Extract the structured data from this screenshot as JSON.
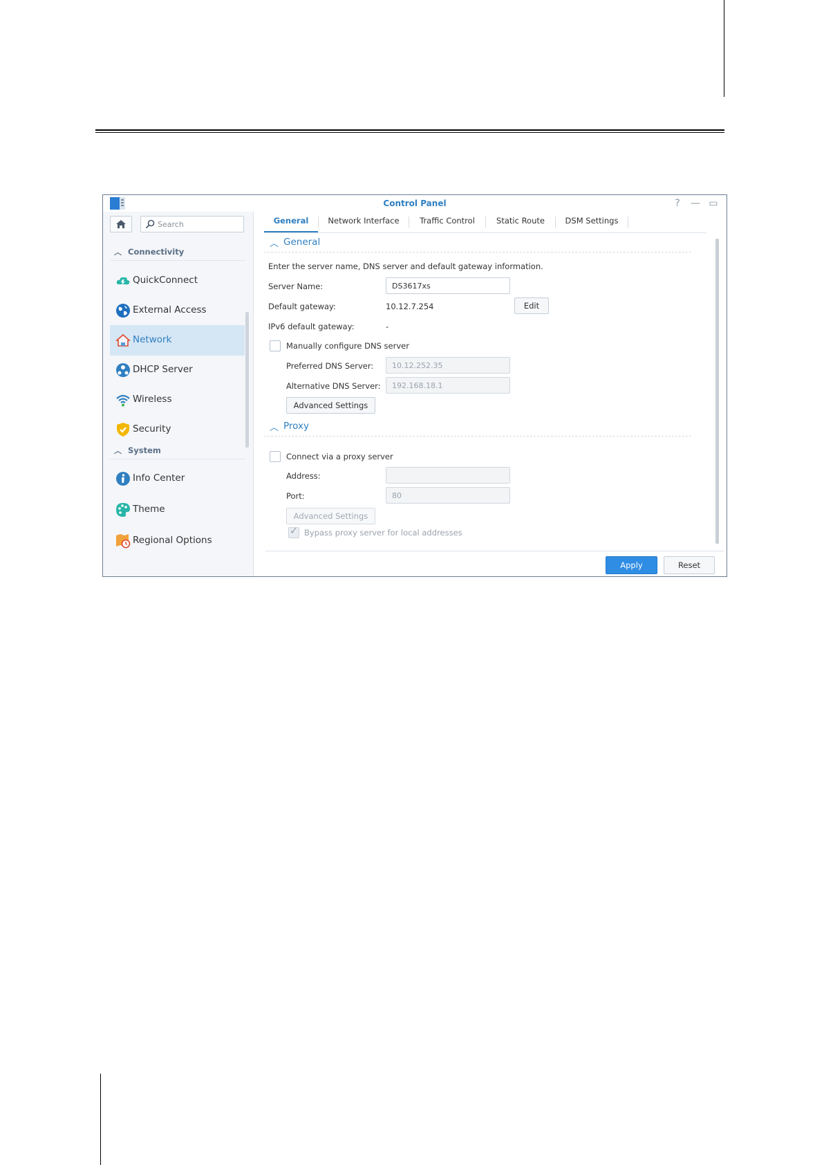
{
  "window": {
    "title": "Control Panel",
    "controls": [
      "?",
      "—",
      "▭",
      "✕"
    ]
  },
  "sidebar": {
    "search_placeholder": "Search",
    "sections": [
      {
        "label": "Connectivity",
        "items": [
          {
            "label": "QuickConnect",
            "icon": "quickconnect-icon"
          },
          {
            "label": "External Access",
            "icon": "globe-icon"
          },
          {
            "label": "Network",
            "icon": "house-icon",
            "active": true
          },
          {
            "label": "DHCP Server",
            "icon": "dhcp-icon"
          },
          {
            "label": "Wireless",
            "icon": "wifi-icon"
          },
          {
            "label": "Security",
            "icon": "shield-icon"
          }
        ]
      },
      {
        "label": "System",
        "items": [
          {
            "label": "Info Center",
            "icon": "info-icon"
          },
          {
            "label": "Theme",
            "icon": "palette-icon"
          },
          {
            "label": "Regional Options",
            "icon": "regional-icon"
          }
        ]
      }
    ]
  },
  "tabs": [
    "General",
    "Network Interface",
    "Traffic Control",
    "Static Route",
    "DSM Settings"
  ],
  "general": {
    "heading": "General",
    "description": "Enter the server name, DNS server and default gateway information.",
    "server_name_label": "Server Name:",
    "server_name_value": "DS3617xs",
    "default_gateway_label": "Default gateway:",
    "default_gateway_value": "10.12.7.254",
    "edit_label": "Edit",
    "ipv6_gateway_label": "IPv6 default gateway:",
    "ipv6_gateway_value": "-",
    "manual_dns_label": "Manually configure DNS server",
    "preferred_dns_label": "Preferred DNS Server:",
    "preferred_dns_value": "10.12.252.35",
    "alternative_dns_label": "Alternative DNS Server:",
    "alternative_dns_value": "192.168.18.1",
    "advanced_settings_label": "Advanced Settings"
  },
  "proxy": {
    "heading": "Proxy",
    "connect_label": "Connect via a proxy server",
    "address_label": "Address:",
    "address_value": "",
    "port_label": "Port:",
    "port_value": "80",
    "advanced_settings_label": "Advanced Settings",
    "bypass_label": "Bypass proxy server for local addresses"
  },
  "footer": {
    "apply_label": "Apply",
    "reset_label": "Reset"
  },
  "colors": {
    "accent": "#2f7fc1",
    "apply": "#2f8de4",
    "active_row": "#d5e6f5"
  }
}
